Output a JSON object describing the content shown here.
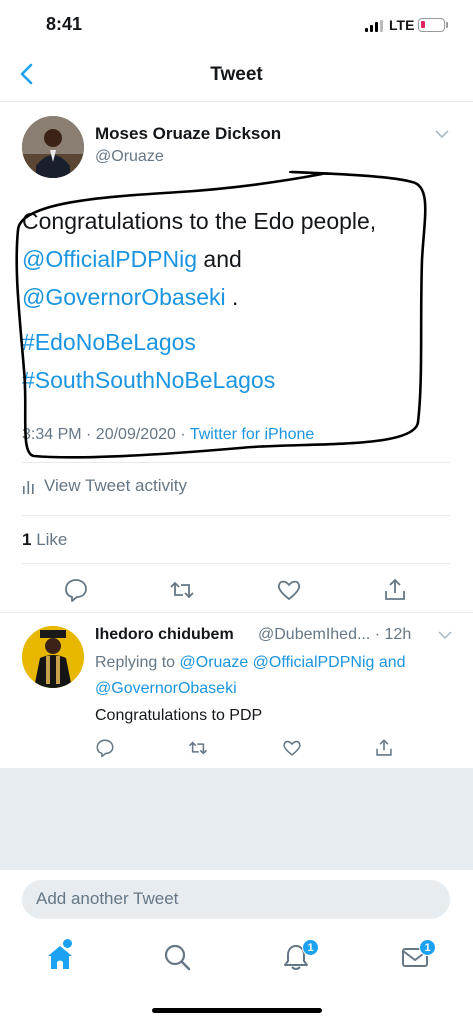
{
  "status_bar": {
    "time": "8:41",
    "network": "LTE"
  },
  "header": {
    "title": "Tweet"
  },
  "tweet": {
    "author_name": "Moses Oruaze Dickson",
    "author_handle": "@Oruaze",
    "text_line1": "Congratulations to the Edo people,",
    "mention1": "@OfficialPDPNig",
    "text_and": " and",
    "mention2": "@GovernorObaseki",
    "text_period": " .",
    "hashtag1": "#EdoNoBeLagos",
    "hashtag2": "#SouthSouthNoBeLagos",
    "timestamp": "3:34 PM · 20/09/2020 · ",
    "source": "Twitter for iPhone",
    "activity_label": "View Tweet activity",
    "likes_count": "1",
    "likes_label": " Like"
  },
  "reply": {
    "author_name": "Ihedoro chidubem",
    "author_handle": "@DubemIhed... · 12h",
    "replying_prefix": "Replying to ",
    "replying_mentions": "@Oruaze @OfficialPDPNig",
    "replying_and": " and",
    "replying_mention_last": "@GovernorObaseki",
    "text": "Congratulations to PDP"
  },
  "compose": {
    "placeholder": "Add another Tweet"
  },
  "nav": {
    "notifications_badge": "1",
    "messages_badge": "1"
  },
  "colors": {
    "link": "#1b95e0",
    "accent": "#1da1f2",
    "muted": "#657786",
    "divider": "#e6ecf0"
  }
}
